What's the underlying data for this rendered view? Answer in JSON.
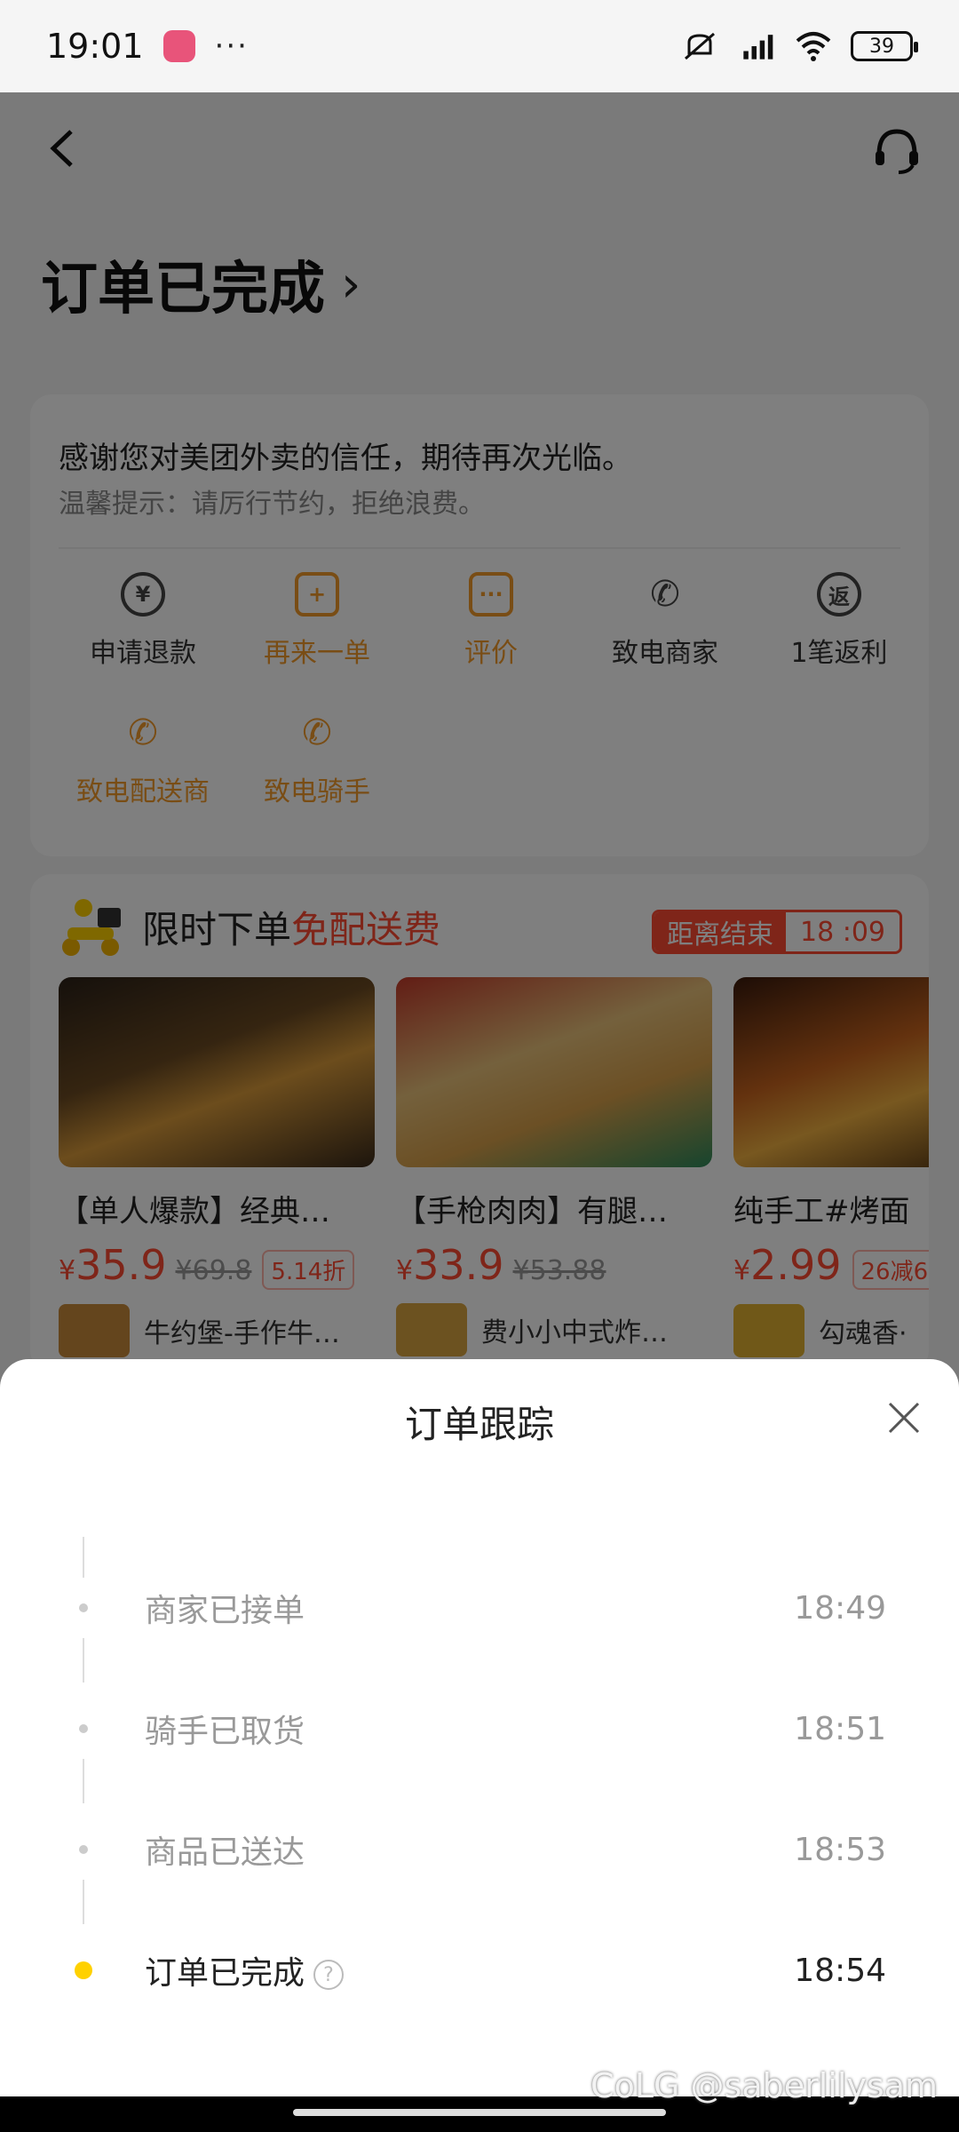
{
  "status_bar": {
    "time": "19:01",
    "more": "···",
    "battery": "39"
  },
  "page": {
    "title": "订单已完成",
    "title_chevron": "›",
    "thanks": "感谢您对美团外卖的信任，期待再次光临。",
    "tip": "温馨提示：请厉行节约，拒绝浪费。",
    "actions": [
      {
        "label": "申请退款",
        "icon": "yen-refund-icon",
        "glyph": "¥"
      },
      {
        "label": "再来一单",
        "icon": "reorder-icon",
        "glyph": "+"
      },
      {
        "label": "评价",
        "icon": "review-chat-icon",
        "glyph": "···"
      },
      {
        "label": "致电商家",
        "icon": "phone-merchant-icon",
        "glyph": "✆"
      },
      {
        "label": "1笔返利",
        "icon": "rebate-icon",
        "glyph": "返"
      },
      {
        "label": "致电配送商",
        "icon": "phone-courier-icon",
        "glyph": "✆"
      },
      {
        "label": "致电骑手",
        "icon": "phone-rider-icon",
        "glyph": "✆"
      }
    ],
    "promo": {
      "title_prefix": "限时下单",
      "title_highlight": "免配送费",
      "countdown_label": "距离结束",
      "countdown_time": "18 :09"
    },
    "foods": [
      {
        "name": "【单人爆款】经典…",
        "price": "35.9",
        "old_price": "¥69.8",
        "discount": "5.14折",
        "shop": "牛约堡-手作牛…"
      },
      {
        "name": "【手枪肉肉】有腿…",
        "price": "33.9",
        "old_price": "¥53.88",
        "discount": "",
        "shop": "费小小中式炸…"
      },
      {
        "name": "纯手工#烤面",
        "price": "2.99",
        "old_price": "",
        "discount": "26减6",
        "shop": "勾魂香·"
      }
    ],
    "currency": "¥"
  },
  "sheet": {
    "title": "订单跟踪",
    "steps": [
      {
        "label": "商家已接单",
        "time": "18:49",
        "active": false
      },
      {
        "label": "骑手已取货",
        "time": "18:51",
        "active": false
      },
      {
        "label": "商品已送达",
        "time": "18:53",
        "active": false
      },
      {
        "label": "订单已完成",
        "time": "18:54",
        "active": true
      }
    ],
    "help": "?"
  },
  "watermark": "CoLG @saberlilysam",
  "colors": {
    "accent_orange": "#f39a2b",
    "promo_red": "#ff4b33",
    "active_dot": "#ffd100"
  }
}
